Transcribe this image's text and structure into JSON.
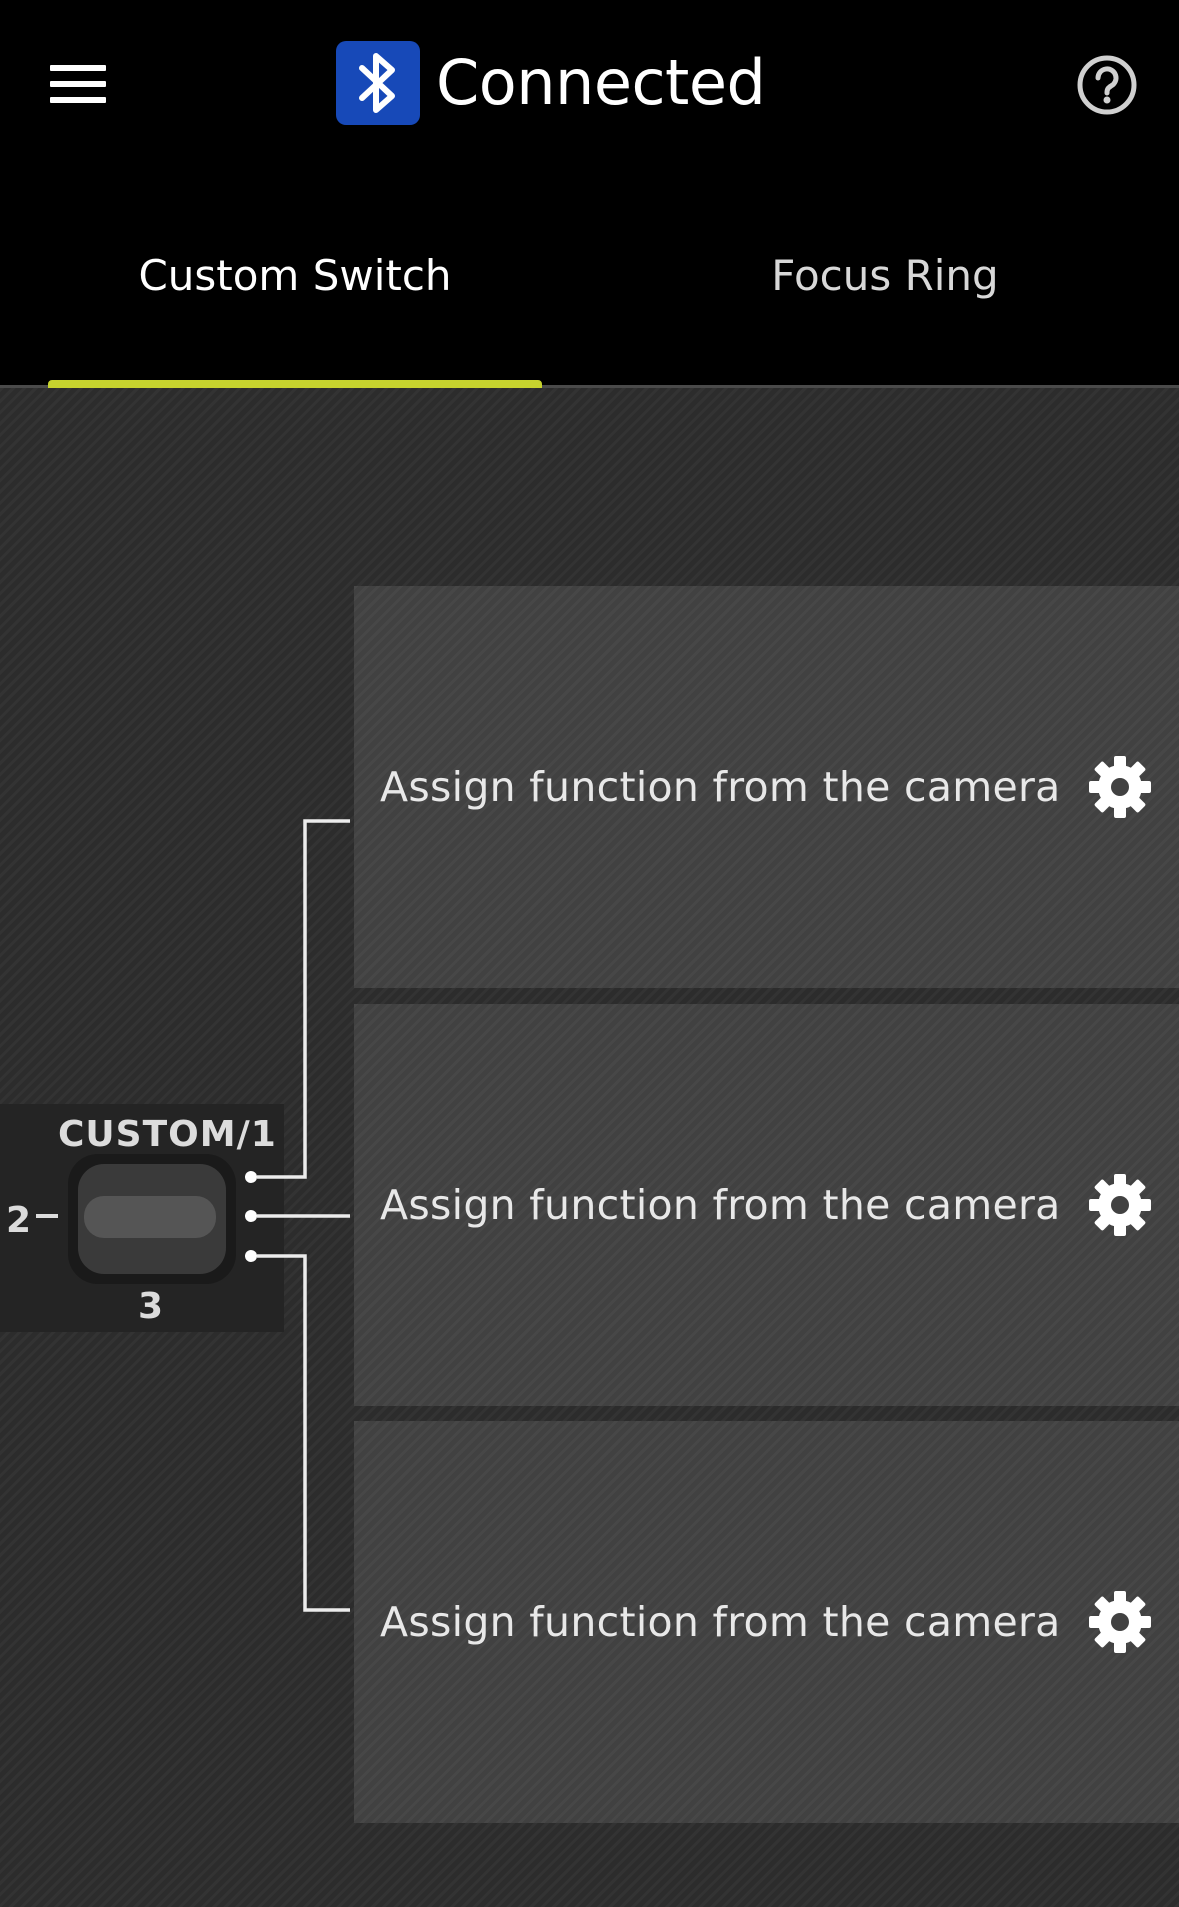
{
  "header": {
    "title": "Connected",
    "icons": {
      "menu": "menu-icon",
      "bluetooth": "bluetooth-icon",
      "help": "help-icon"
    },
    "bluetooth_badge_color": "#1749b8"
  },
  "tabs": [
    {
      "label": "Custom Switch",
      "selected": true
    },
    {
      "label": "Focus Ring",
      "selected": false
    }
  ],
  "tab_indicator_color": "#c6d32e",
  "switch": {
    "top_label": "CUSTOM/1",
    "left_label": "2",
    "bottom_label": "3"
  },
  "slots": [
    {
      "label": "Assign function from the camera",
      "icon": "gear-icon"
    },
    {
      "label": "Assign function from the camera",
      "icon": "gear-icon"
    },
    {
      "label": "Assign function from the camera",
      "icon": "gear-icon"
    }
  ]
}
